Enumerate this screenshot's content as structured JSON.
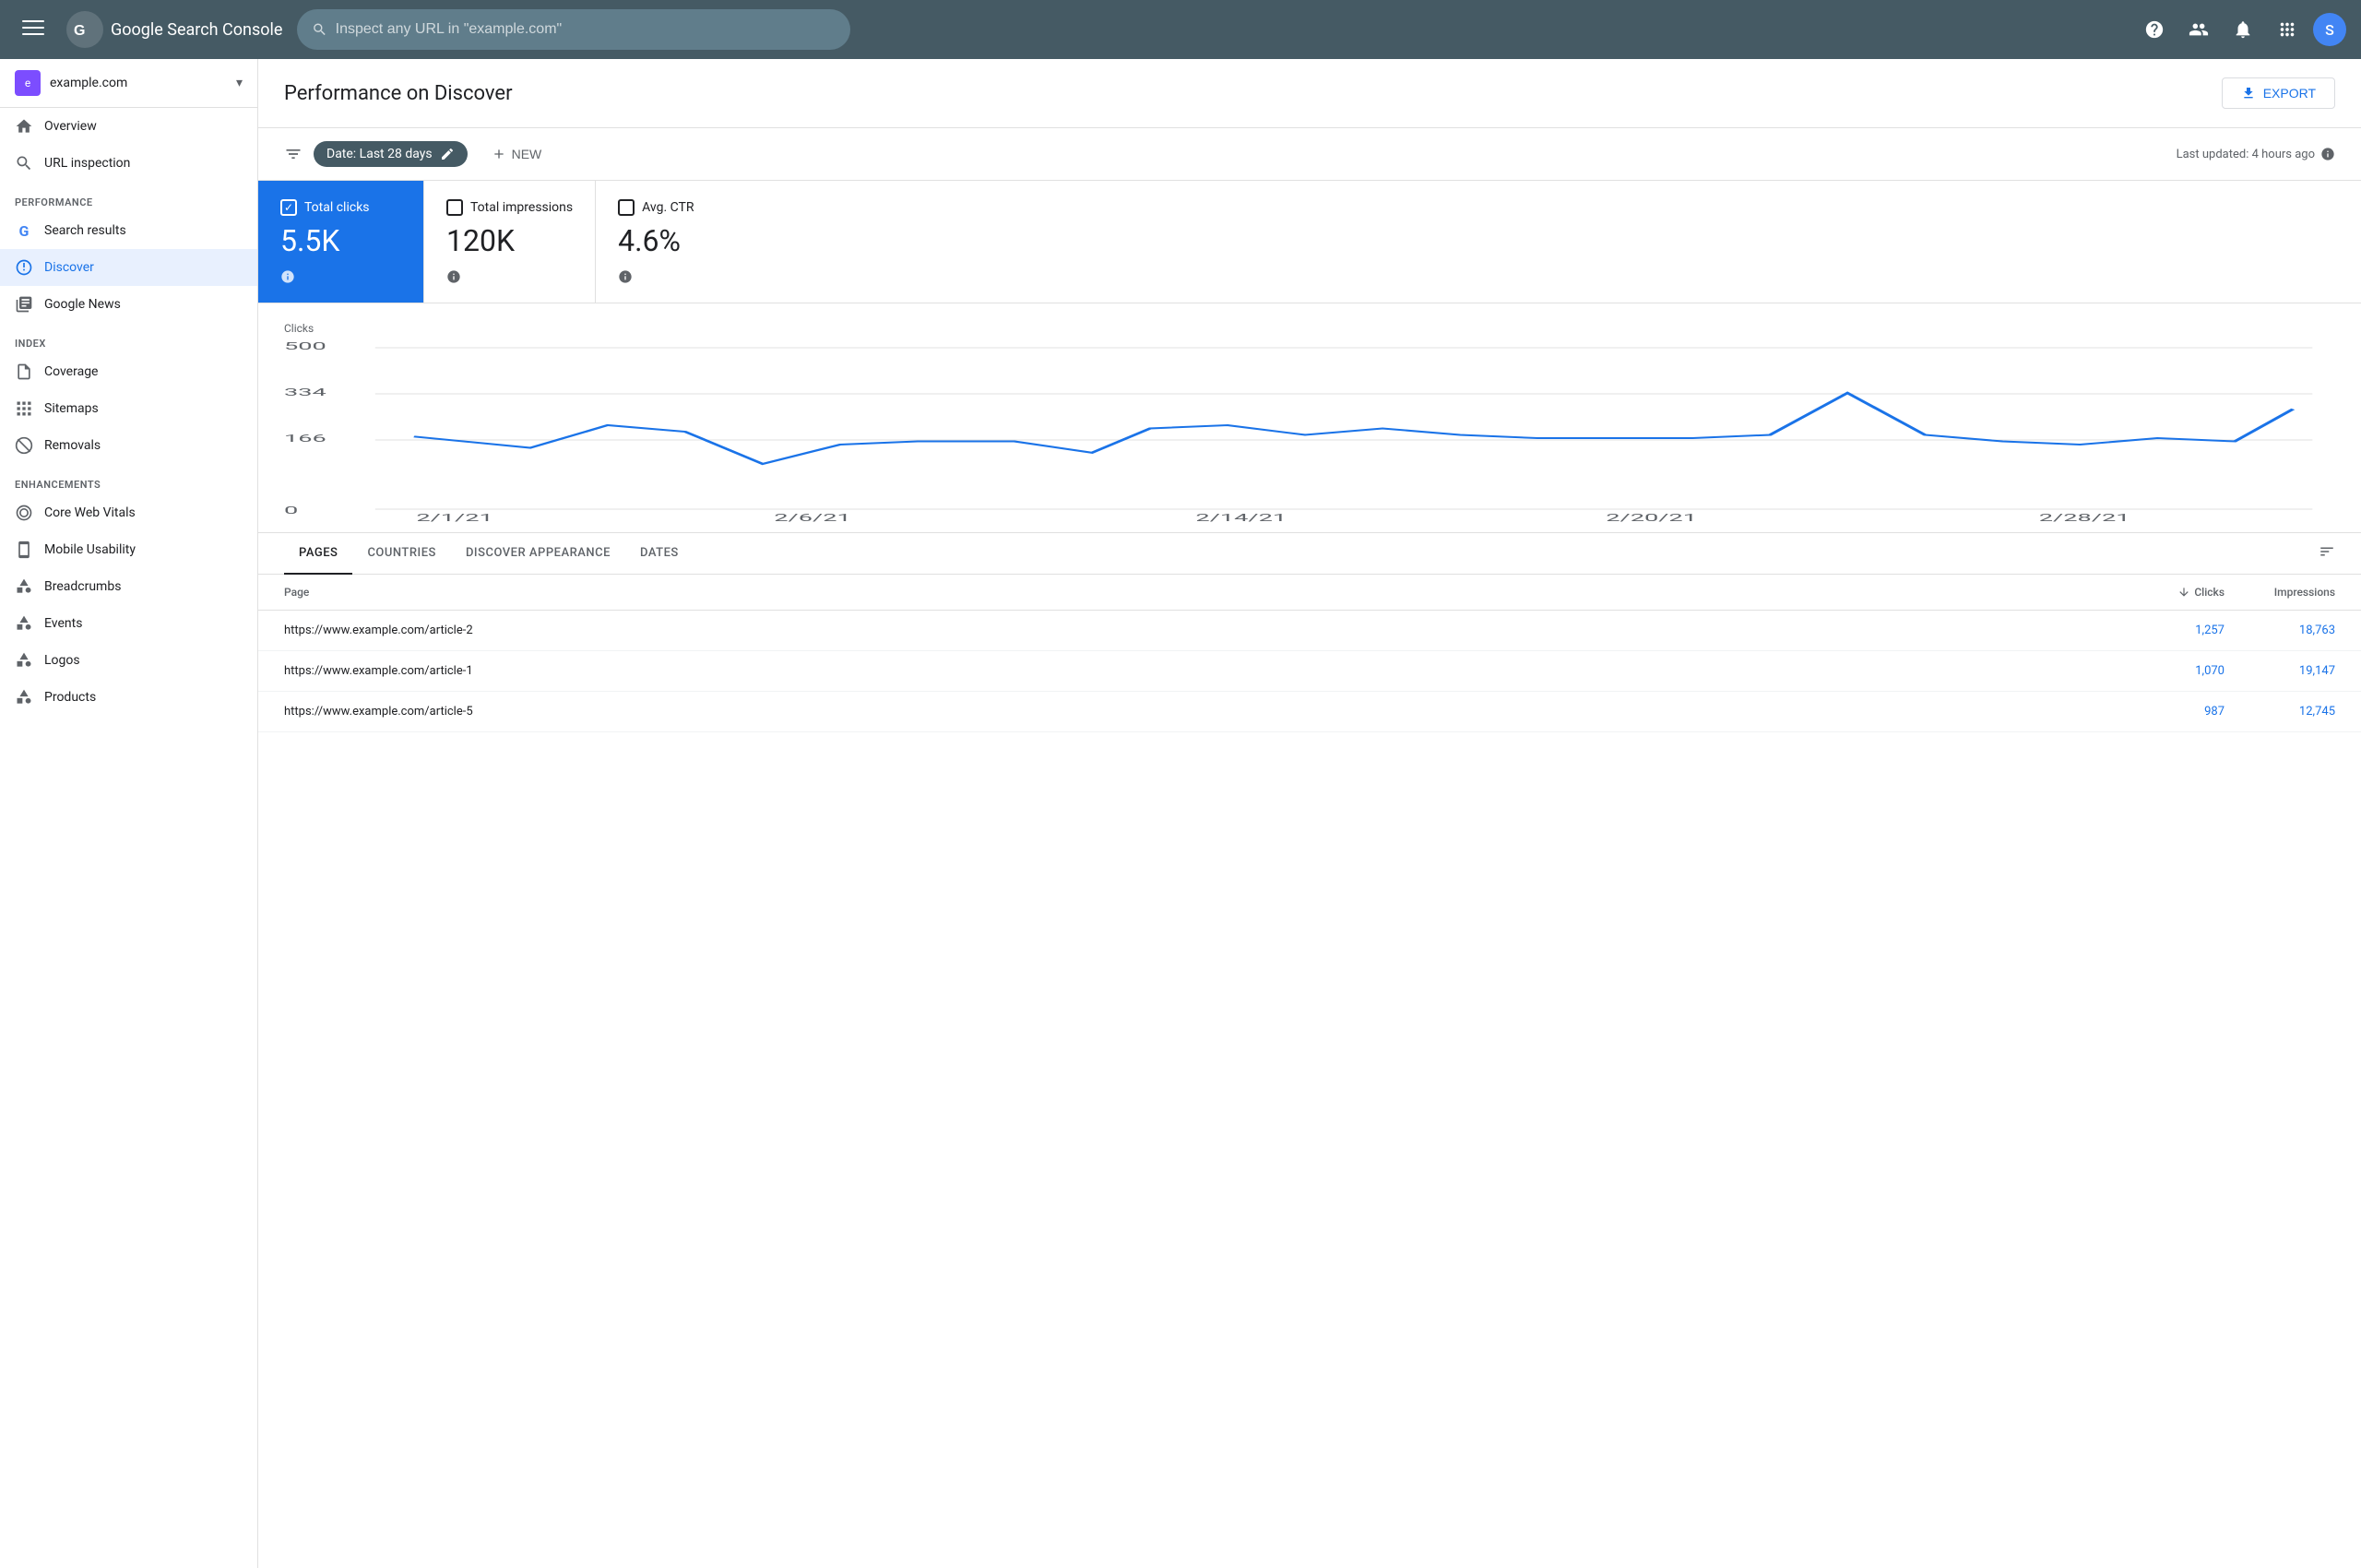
{
  "topbar": {
    "menu_label": "☰",
    "logo_text": "Google Search Console",
    "search_placeholder": "Inspect any URL in \"example.com\"",
    "help_icon": "?",
    "users_icon": "👤",
    "bell_icon": "🔔",
    "grid_icon": "⊞",
    "avatar_letter": "S"
  },
  "sidebar": {
    "property": {
      "name": "example.com",
      "icon_letter": "e"
    },
    "items": [
      {
        "label": "Overview",
        "icon": "🏠",
        "section": null,
        "active": false
      },
      {
        "label": "URL inspection",
        "icon": "🔍",
        "section": null,
        "active": false
      },
      {
        "label": "Search results",
        "icon": "G",
        "section": "Performance",
        "active": false
      },
      {
        "label": "Discover",
        "icon": "✳",
        "section": null,
        "active": true
      },
      {
        "label": "Google News",
        "icon": "▦",
        "section": null,
        "active": false
      },
      {
        "label": "Coverage",
        "icon": "📄",
        "section": "Index",
        "active": false
      },
      {
        "label": "Sitemaps",
        "icon": "⊞",
        "section": null,
        "active": false
      },
      {
        "label": "Removals",
        "icon": "🚫",
        "section": null,
        "active": false
      },
      {
        "label": "Core Web Vitals",
        "icon": "◎",
        "section": "Enhancements",
        "active": false
      },
      {
        "label": "Mobile Usability",
        "icon": "📱",
        "section": null,
        "active": false
      },
      {
        "label": "Breadcrumbs",
        "icon": "◇",
        "section": null,
        "active": false
      },
      {
        "label": "Events",
        "icon": "◇",
        "section": null,
        "active": false
      },
      {
        "label": "Logos",
        "icon": "◇",
        "section": null,
        "active": false
      },
      {
        "label": "Products",
        "icon": "◇",
        "section": null,
        "active": false
      }
    ],
    "sections": [
      "Performance",
      "Index",
      "Enhancements"
    ]
  },
  "page": {
    "title": "Performance on Discover",
    "export_label": "EXPORT",
    "last_updated": "Last updated: 4 hours ago"
  },
  "filter_bar": {
    "date_filter": "Date: Last 28 days",
    "new_label": "NEW"
  },
  "metrics": [
    {
      "label": "Total clicks",
      "value": "5.5K",
      "checked": true,
      "active": true
    },
    {
      "label": "Total impressions",
      "value": "120K",
      "checked": false,
      "active": false
    },
    {
      "label": "Avg. CTR",
      "value": "4.6%",
      "checked": false,
      "active": false
    }
  ],
  "chart": {
    "y_label": "Clicks",
    "y_ticks": [
      "500",
      "334",
      "166",
      "0"
    ],
    "x_ticks": [
      "2/1/21",
      "2/6/21",
      "2/14/21",
      "2/20/21",
      "2/28/21"
    ],
    "data_points": [
      {
        "x": 0.02,
        "y": 0.45
      },
      {
        "x": 0.08,
        "y": 0.38
      },
      {
        "x": 0.12,
        "y": 0.52
      },
      {
        "x": 0.16,
        "y": 0.48
      },
      {
        "x": 0.2,
        "y": 0.28
      },
      {
        "x": 0.24,
        "y": 0.4
      },
      {
        "x": 0.28,
        "y": 0.42
      },
      {
        "x": 0.33,
        "y": 0.42
      },
      {
        "x": 0.37,
        "y": 0.35
      },
      {
        "x": 0.4,
        "y": 0.5
      },
      {
        "x": 0.44,
        "y": 0.52
      },
      {
        "x": 0.48,
        "y": 0.46
      },
      {
        "x": 0.52,
        "y": 0.5
      },
      {
        "x": 0.56,
        "y": 0.46
      },
      {
        "x": 0.6,
        "y": 0.44
      },
      {
        "x": 0.64,
        "y": 0.44
      },
      {
        "x": 0.68,
        "y": 0.44
      },
      {
        "x": 0.72,
        "y": 0.46
      },
      {
        "x": 0.76,
        "y": 0.72
      },
      {
        "x": 0.8,
        "y": 0.46
      },
      {
        "x": 0.84,
        "y": 0.42
      },
      {
        "x": 0.88,
        "y": 0.4
      },
      {
        "x": 0.92,
        "y": 0.44
      },
      {
        "x": 0.96,
        "y": 0.42
      },
      {
        "x": 0.99,
        "y": 0.62
      }
    ]
  },
  "tabs": [
    {
      "label": "PAGES",
      "active": true
    },
    {
      "label": "COUNTRIES",
      "active": false
    },
    {
      "label": "DISCOVER APPEARANCE",
      "active": false
    },
    {
      "label": "DATES",
      "active": false
    }
  ],
  "table": {
    "col_page": "Page",
    "col_clicks": "Clicks",
    "col_impressions": "Impressions",
    "rows": [
      {
        "page": "https://www.example.com/article-2",
        "clicks": "1,257",
        "impressions": "18,763"
      },
      {
        "page": "https://www.example.com/article-1",
        "clicks": "1,070",
        "impressions": "19,147"
      },
      {
        "page": "https://www.example.com/article-5",
        "clicks": "987",
        "impressions": "12,745"
      }
    ]
  }
}
